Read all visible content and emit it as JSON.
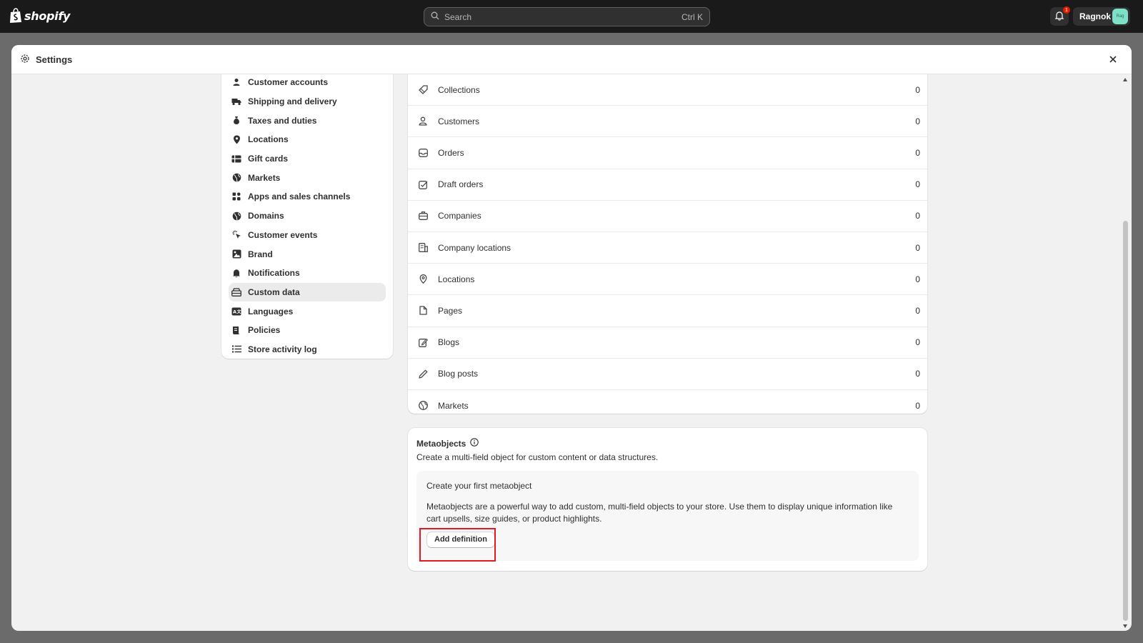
{
  "topbar": {
    "brand": "shopify",
    "search_placeholder": "Search",
    "search_shortcut": "Ctrl K",
    "notification_count": "1",
    "user_name": "Ragnok",
    "user_initials": "Rag"
  },
  "modal": {
    "title": "Settings"
  },
  "sidebar": {
    "items": [
      {
        "label": "Customer accounts",
        "icon": "person-icon"
      },
      {
        "label": "Shipping and delivery",
        "icon": "truck-icon"
      },
      {
        "label": "Taxes and duties",
        "icon": "money-bag-icon"
      },
      {
        "label": "Locations",
        "icon": "location-pin-icon"
      },
      {
        "label": "Gift cards",
        "icon": "gift-card-icon"
      },
      {
        "label": "Markets",
        "icon": "globe-icon"
      },
      {
        "label": "Apps and sales channels",
        "icon": "apps-icon"
      },
      {
        "label": "Domains",
        "icon": "globe-icon"
      },
      {
        "label": "Customer events",
        "icon": "cursor-click-icon"
      },
      {
        "label": "Brand",
        "icon": "brand-icon"
      },
      {
        "label": "Notifications",
        "icon": "bell-icon"
      },
      {
        "label": "Custom data",
        "icon": "custom-data-icon",
        "active": true
      },
      {
        "label": "Languages",
        "icon": "language-icon"
      },
      {
        "label": "Policies",
        "icon": "policy-icon"
      },
      {
        "label": "Store activity log",
        "icon": "list-icon"
      }
    ]
  },
  "metafields": {
    "rows": [
      {
        "label": "Collections",
        "count": "0",
        "icon": "collection-icon"
      },
      {
        "label": "Customers",
        "count": "0",
        "icon": "person-icon"
      },
      {
        "label": "Orders",
        "count": "0",
        "icon": "inbox-icon"
      },
      {
        "label": "Draft orders",
        "count": "0",
        "icon": "draft-order-icon"
      },
      {
        "label": "Companies",
        "count": "0",
        "icon": "company-icon"
      },
      {
        "label": "Company locations",
        "count": "0",
        "icon": "company-location-icon"
      },
      {
        "label": "Locations",
        "count": "0",
        "icon": "location-pin-icon"
      },
      {
        "label": "Pages",
        "count": "0",
        "icon": "page-icon"
      },
      {
        "label": "Blogs",
        "count": "0",
        "icon": "blog-icon"
      },
      {
        "label": "Blog posts",
        "count": "0",
        "icon": "pencil-icon"
      },
      {
        "label": "Markets",
        "count": "0",
        "icon": "globe-icon"
      }
    ]
  },
  "metaobjects": {
    "title": "Metaobjects",
    "description": "Create a multi-field object for custom content or data structures.",
    "empty_title": "Create your first metaobject",
    "empty_text": "Metaobjects are a powerful way to add custom, multi-field objects to your store. Use them to display unique information like cart upsells, size guides, or product highlights.",
    "add_button": "Add definition"
  },
  "colors": {
    "topbar": "#1a1a1a",
    "modal_bg": "#f1f1f1",
    "highlight": "#e01b24",
    "notification_badge": "#e51c00",
    "avatar": "#7ee0c6"
  }
}
